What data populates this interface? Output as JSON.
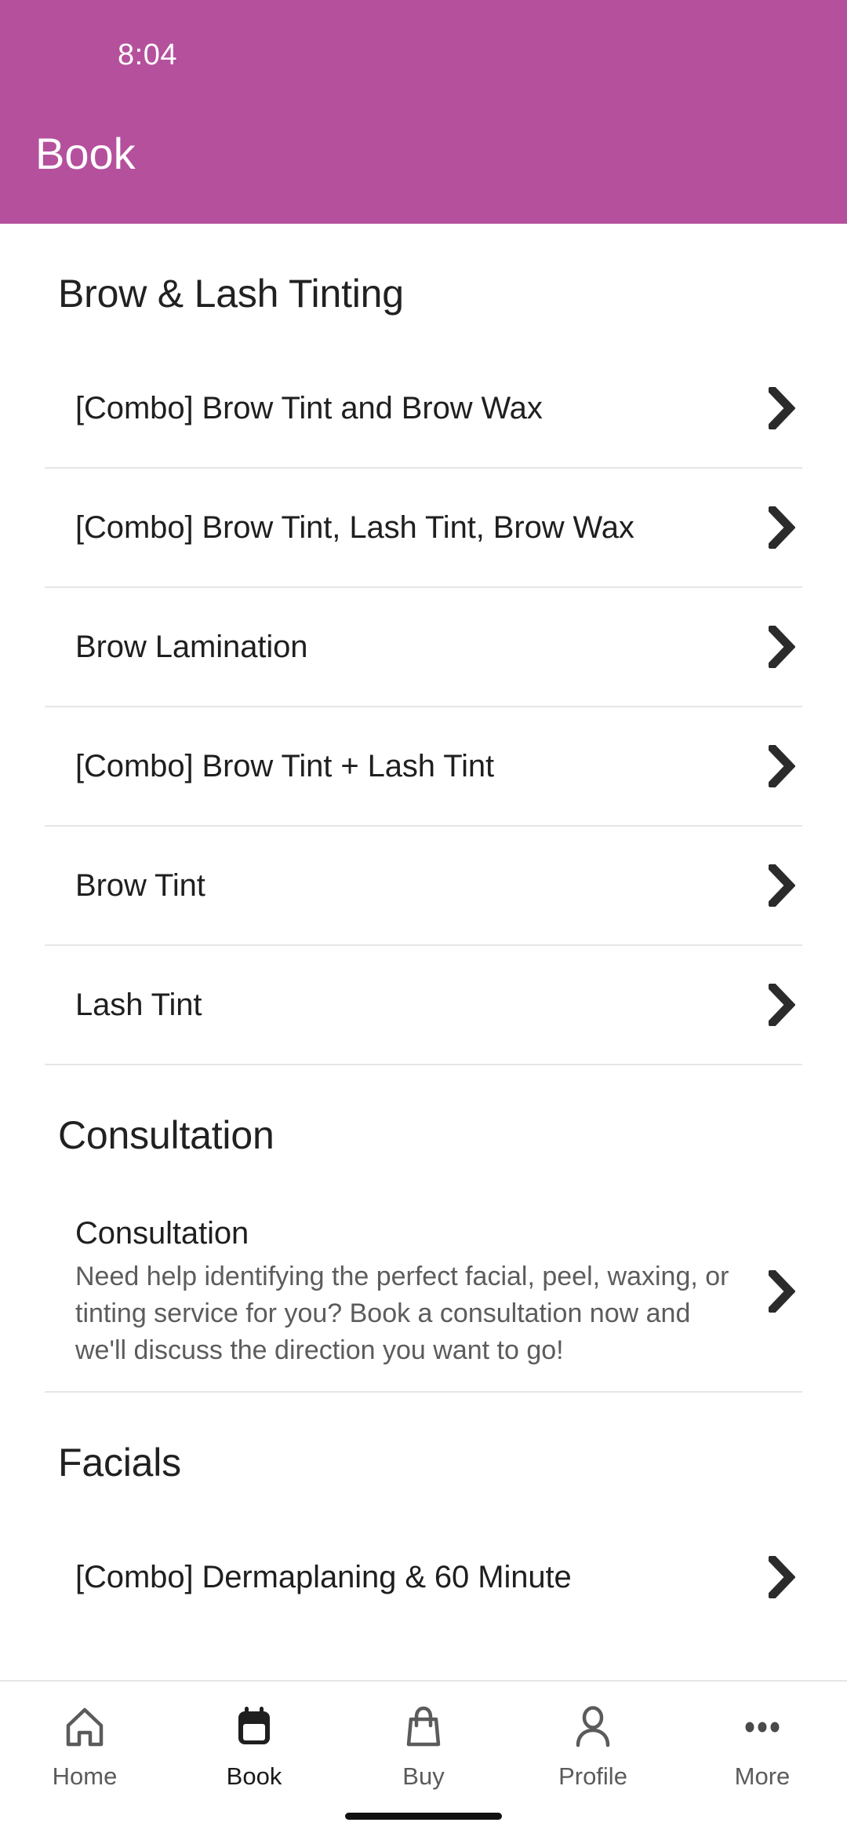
{
  "status_bar": {
    "time": "8:04"
  },
  "header": {
    "title": "Book",
    "background_color": "#b5509d",
    "text_color": "#ffffff"
  },
  "sections": [
    {
      "title": "Brow & Lash Tinting",
      "items": [
        {
          "title": "[Combo] Brow Tint and Brow Wax",
          "description": ""
        },
        {
          "title": "[Combo] Brow Tint, Lash Tint, Brow Wax",
          "description": ""
        },
        {
          "title": "Brow Lamination",
          "description": ""
        },
        {
          "title": "[Combo] Brow Tint + Lash Tint",
          "description": ""
        },
        {
          "title": "Brow Tint",
          "description": ""
        },
        {
          "title": "Lash Tint",
          "description": ""
        }
      ]
    },
    {
      "title": "Consultation",
      "items": [
        {
          "title": "Consultation",
          "description": "Need help identifying the perfect facial, peel, waxing, or tinting service for you? Book a consultation now and we'll discuss the direction you want to go!"
        }
      ]
    },
    {
      "title": "Facials",
      "items": [
        {
          "title": "[Combo] Dermaplaning & 60 Minute",
          "description": ""
        }
      ]
    }
  ],
  "icons": {
    "chevron": "chevron-right-icon"
  },
  "bottom_nav": {
    "active_index": 1,
    "items": [
      {
        "label": "Home",
        "icon": "home-icon"
      },
      {
        "label": "Book",
        "icon": "calendar-icon"
      },
      {
        "label": "Buy",
        "icon": "shopping-bag-icon"
      },
      {
        "label": "Profile",
        "icon": "person-icon"
      },
      {
        "label": "More",
        "icon": "ellipsis-icon"
      }
    ]
  }
}
